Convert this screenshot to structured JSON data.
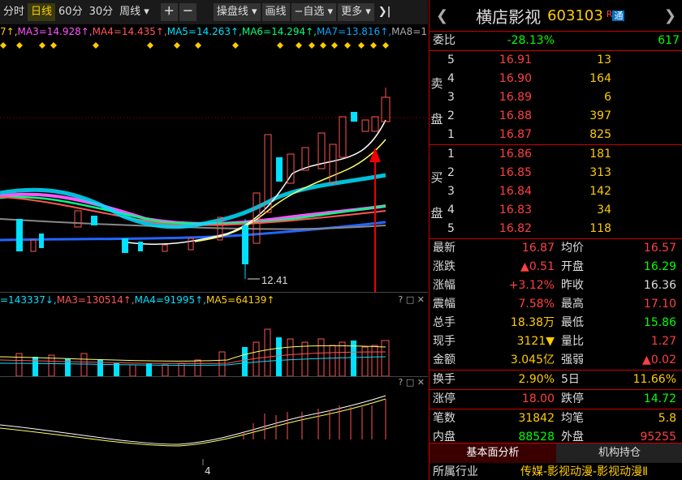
{
  "toolbar": {
    "items": [
      "分时",
      "日线",
      "60分",
      "30分",
      "周线 ▾",
      "＋",
      "－",
      "操盘线 ▾",
      "画线",
      "−自选 ▾",
      "更多 ▾",
      "❯|"
    ]
  },
  "ma_line": [
    {
      "text": "7↑,",
      "color": "#ffcc00"
    },
    {
      "text": "MA3=14.928↑,",
      "color": "#ff55ff"
    },
    {
      "text": "MA4=14.435↑,",
      "color": "#ff5555"
    },
    {
      "text": "MA5=14.263↑,",
      "color": "#00e0ff"
    },
    {
      "text": "MA6=14.294↑,",
      "color": "#00ff80"
    },
    {
      "text": "MA7=13.816↑,",
      "color": "#00aaff"
    },
    {
      "text": "MA8=1",
      "color": "#aaaaaa"
    }
  ],
  "low_label": "12.41",
  "vol_line": [
    {
      "text": "=143337↓,",
      "color": "#00e0ff"
    },
    {
      "text": "MA3=130514↑,",
      "color": "#ff5555"
    },
    {
      "text": "MA4=91995↑,",
      "color": "#00e0ff"
    },
    {
      "text": "MA5=64139↑",
      "color": "#ffcc00"
    }
  ],
  "hdr_icons": "? □ ✕",
  "date_label": "4",
  "stock": {
    "name": "横店影视",
    "code": "603103",
    "r": "R",
    "tong": "通",
    "nav_left": "❮",
    "nav_right": "❯"
  },
  "weibi": {
    "label": "委比",
    "value": "-28.13%",
    "diff": "617"
  },
  "sell_side": "卖\n盘",
  "buy_side": "买\n盘",
  "sell": [
    {
      "lvl": "5",
      "price": "16.91",
      "vol": "13"
    },
    {
      "lvl": "4",
      "price": "16.90",
      "vol": "164"
    },
    {
      "lvl": "3",
      "price": "16.89",
      "vol": "6"
    },
    {
      "lvl": "2",
      "price": "16.88",
      "vol": "397"
    },
    {
      "lvl": "1",
      "price": "16.87",
      "vol": "825"
    }
  ],
  "buy": [
    {
      "lvl": "1",
      "price": "16.86",
      "vol": "181"
    },
    {
      "lvl": "2",
      "price": "16.85",
      "vol": "313"
    },
    {
      "lvl": "3",
      "price": "16.84",
      "vol": "142"
    },
    {
      "lvl": "4",
      "price": "16.83",
      "vol": "34"
    },
    {
      "lvl": "5",
      "price": "16.82",
      "vol": "118"
    }
  ],
  "stats": [
    {
      "l1": "最新",
      "v1": "16.87",
      "c1": "#ff4040",
      "l2": "均价",
      "v2": "16.57",
      "c2": "#ff4040"
    },
    {
      "l1": "涨跌",
      "v1": "▲0.51",
      "c1": "#ff4040",
      "l2": "开盘",
      "v2": "16.29",
      "c2": "#00ff00"
    },
    {
      "l1": "涨幅",
      "v1": "+3.12%",
      "c1": "#ff4040",
      "l2": "昨收",
      "v2": "16.36",
      "c2": "#dddddd"
    },
    {
      "l1": "震幅",
      "v1": "7.58%",
      "c1": "#ff4040",
      "l2": "最高",
      "v2": "17.10",
      "c2": "#ff4040"
    },
    {
      "l1": "总手",
      "v1": "18.38万",
      "c1": "#ffcc00",
      "l2": "最低",
      "v2": "15.86",
      "c2": "#00ff00"
    },
    {
      "l1": "现手",
      "v1": "3121▼",
      "c1": "#ffcc00",
      "l2": "量比",
      "v2": "1.27",
      "c2": "#ff4040"
    },
    {
      "l1": "金额",
      "v1": "3.045亿",
      "c1": "#ffcc00",
      "l2": "强弱",
      "v2": "▲0.02",
      "c2": "#ff4040"
    },
    {
      "l1": "换手",
      "v1": "2.90%",
      "c1": "#ffcc00",
      "l2": "5日",
      "v2": "11.66%",
      "c2": "#ffcc00"
    },
    {
      "l1": "涨停",
      "v1": "18.00",
      "c1": "#ff4040",
      "l2": "跌停",
      "v2": "14.72",
      "c2": "#00ff00"
    },
    {
      "l1": "笔数",
      "v1": "31842",
      "c1": "#ffcc00",
      "l2": "均笔",
      "v2": "5.8",
      "c2": "#ffcc00"
    },
    {
      "l1": "内盘",
      "v1": "88528",
      "c1": "#00ff00",
      "l2": "外盘",
      "v2": "95255",
      "c2": "#ff4040"
    }
  ],
  "tabs": [
    "基本面分析",
    "机构持仓"
  ],
  "industry": {
    "label": "所属行业",
    "value": "传媒-影视动漫-影视动漫Ⅱ"
  }
}
